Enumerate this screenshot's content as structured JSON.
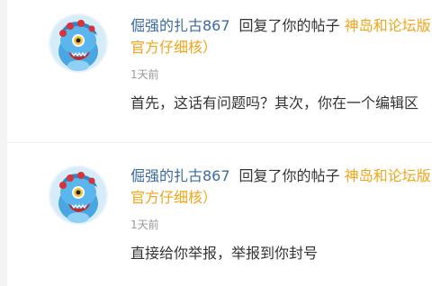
{
  "notifications": [
    {
      "username": "倔强的扎古867",
      "action": "回复了你的帖子",
      "post_title": "神岛和论坛版",
      "post_title_continued": "官方仔细核）",
      "time": "1天前",
      "content": "首先，这话有问题吗？其次，你在一个编辑区",
      "avatar_icon": "blue-pokemon-avatar"
    },
    {
      "username": "倔强的扎古867",
      "action": "回复了你的帖子",
      "post_title": "神岛和论坛版",
      "post_title_continued": "官方仔细核）",
      "time": "1天前",
      "content": "直接给你举报，举报到你封号",
      "avatar_icon": "blue-pokemon-avatar"
    }
  ],
  "colors": {
    "username": "#3b6aa3",
    "post_title": "#f2a51a",
    "time": "#999999",
    "text": "#333333"
  }
}
